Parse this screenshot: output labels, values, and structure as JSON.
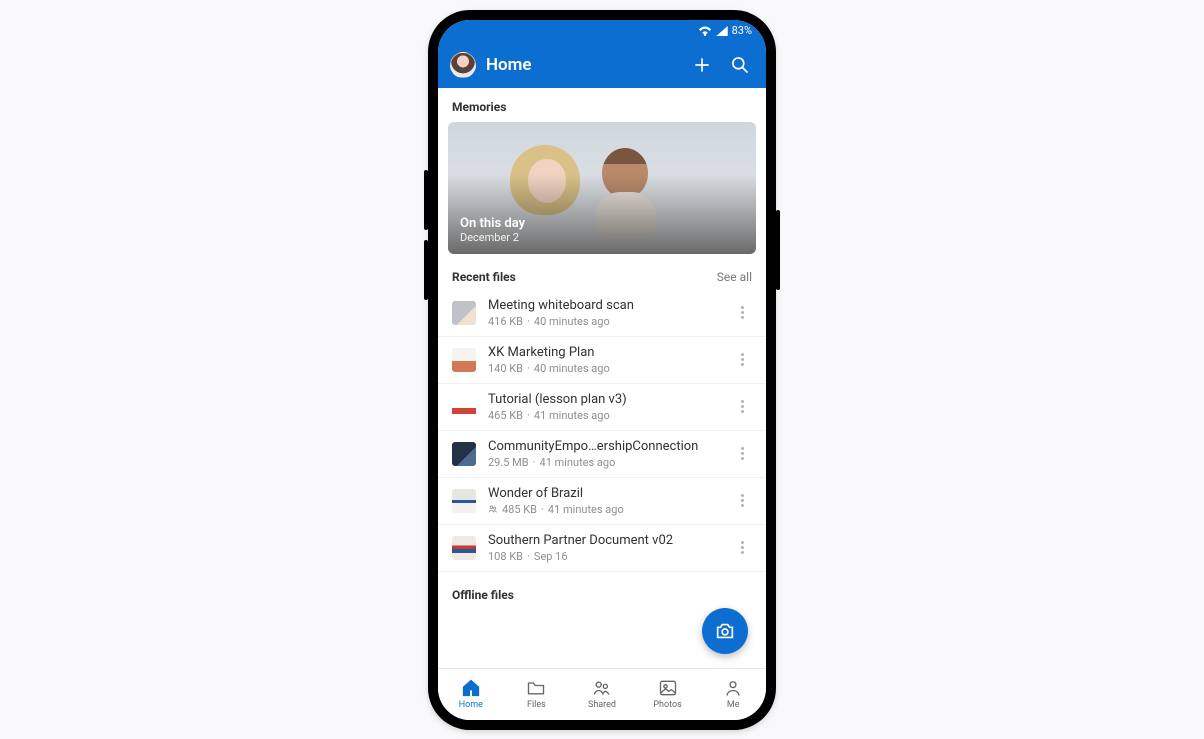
{
  "status": {
    "battery": "83%"
  },
  "header": {
    "title": "Home"
  },
  "memories": {
    "label": "Memories",
    "card": {
      "title": "On this day",
      "date": "December 2"
    }
  },
  "recent": {
    "label": "Recent files",
    "see_all": "See all",
    "files": [
      {
        "name": "Meeting whiteboard scan",
        "size": "416 KB",
        "time": "40 minutes ago",
        "shared": false
      },
      {
        "name": "XK Marketing Plan",
        "size": "140 KB",
        "time": "40 minutes ago",
        "shared": false
      },
      {
        "name": "Tutorial (lesson plan v3)",
        "size": "465 KB",
        "time": "41 minutes ago",
        "shared": false
      },
      {
        "name": "CommunityEmpo…ershipConnection",
        "size": "29.5 MB",
        "time": "41 minutes ago",
        "shared": false
      },
      {
        "name": "Wonder of Brazil",
        "size": "485 KB",
        "time": "41 minutes ago",
        "shared": true
      },
      {
        "name": "Southern Partner Document v02",
        "size": "108 KB",
        "time": "Sep 16",
        "shared": false
      }
    ]
  },
  "offline": {
    "label": "Offline files"
  },
  "nav": {
    "items": [
      {
        "label": "Home"
      },
      {
        "label": "Files"
      },
      {
        "label": "Shared"
      },
      {
        "label": "Photos"
      },
      {
        "label": "Me"
      }
    ]
  }
}
